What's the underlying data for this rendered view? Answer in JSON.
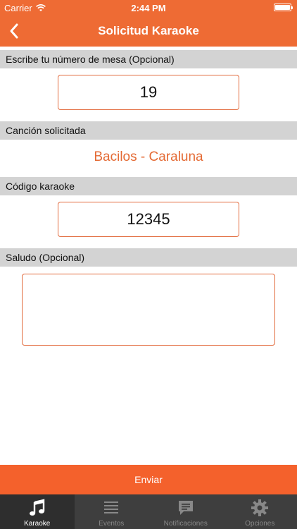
{
  "status_bar": {
    "carrier": "Carrier",
    "time": "2:44 PM"
  },
  "nav": {
    "title": "Solicitud Karaoke"
  },
  "sections": {
    "table": {
      "label": "Escribe tu número de mesa (Opcional)",
      "value": "19"
    },
    "song": {
      "label": "Canción solicitada",
      "value": "Bacilos - Caraluna"
    },
    "code": {
      "label": "Código karaoke",
      "value": "12345"
    },
    "greeting": {
      "label": "Saludo (Opcional)",
      "value": ""
    }
  },
  "send_label": "Enviar",
  "tabs": [
    {
      "label": "Karaoke",
      "icon": "music-note-icon",
      "active": true
    },
    {
      "label": "Eventos",
      "icon": "list-icon",
      "active": false
    },
    {
      "label": "Notificaciones",
      "icon": "chat-bubble-icon",
      "active": false
    },
    {
      "label": "Opciones",
      "icon": "gear-icon",
      "active": false
    }
  ],
  "colors": {
    "accent": "#EE6B34",
    "send": "#F4612C",
    "tabbar": "#3E3E3E",
    "section": "#D3D3D3"
  }
}
